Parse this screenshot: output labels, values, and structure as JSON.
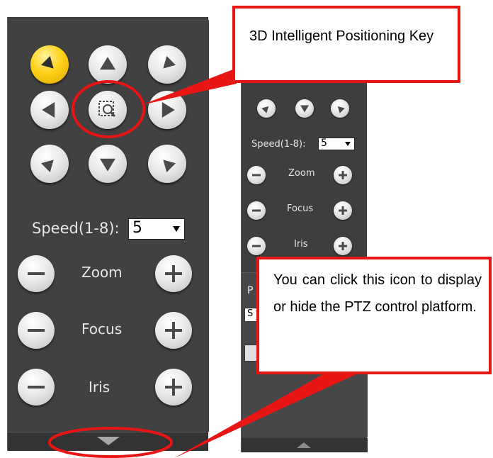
{
  "ptz_large": {
    "speed_label": "Speed(1-8):",
    "speed_value": "5",
    "zoom_label": "Zoom",
    "focus_label": "Focus",
    "iris_label": "Iris"
  },
  "ptz_small": {
    "speed_label": "Speed(1-8):",
    "speed_value": "5",
    "zoom_label": "Zoom",
    "focus_label": "Focus",
    "iris_label": "Iris",
    "fragment_p": "P",
    "fragment_s": "S"
  },
  "callouts": {
    "positioning_key": "3D Intelligent Positioning Key",
    "toggle_panel": "You can click this icon to display or hide the PTZ control platform."
  },
  "colors": {
    "callout_border": "#e81515",
    "panel_bg": "#414141",
    "active_button": "#ffd21a"
  }
}
